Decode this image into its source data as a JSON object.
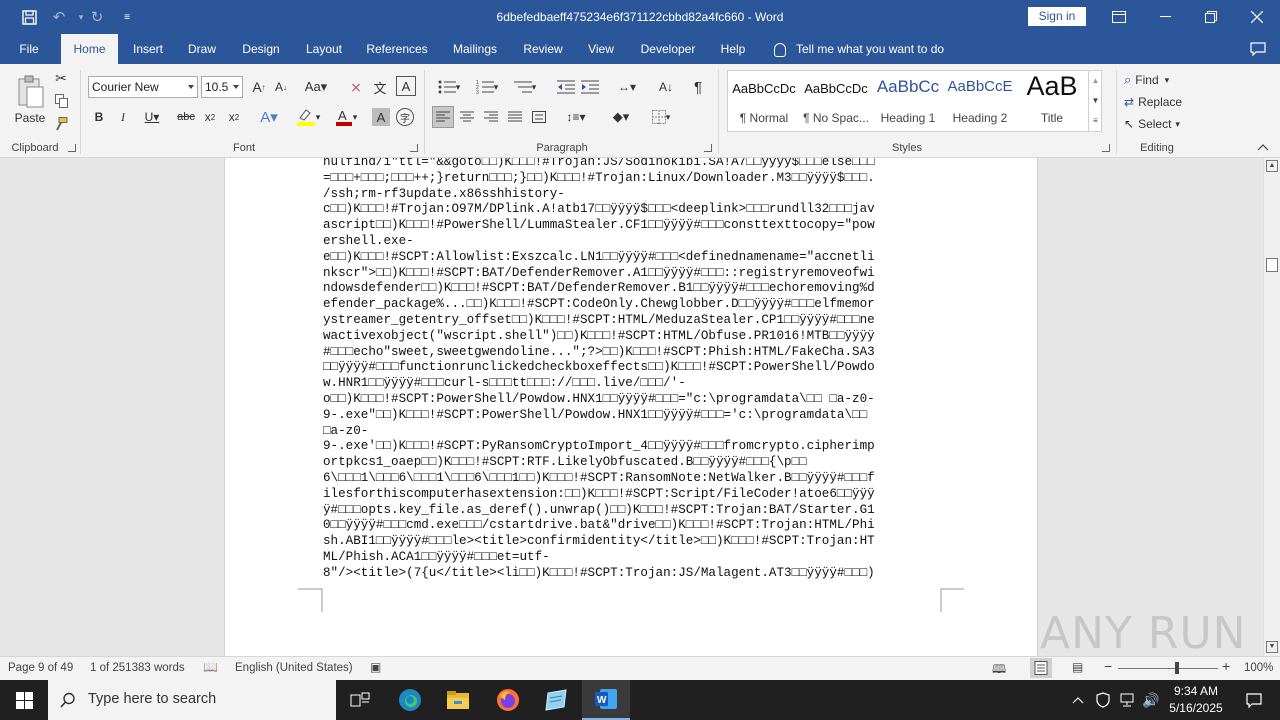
{
  "window": {
    "title": "6dbefedbaeff475234e6f371122cbbd82a4fc660  -  Word",
    "sign_in": "Sign in"
  },
  "tabs": [
    "File",
    "Home",
    "Insert",
    "Draw",
    "Design",
    "Layout",
    "References",
    "Mailings",
    "Review",
    "View",
    "Developer",
    "Help"
  ],
  "tell_me": "Tell me what you want to do",
  "ribbon": {
    "clipboard": {
      "label": "Clipboard",
      "paste": "Paste"
    },
    "font": {
      "label": "Font",
      "name": "Courier New",
      "size": "10.5"
    },
    "paragraph": {
      "label": "Paragraph"
    },
    "styles": {
      "label": "Styles",
      "items": [
        {
          "preview": "AaBbCcDc",
          "name": "¶ Normal"
        },
        {
          "preview": "AaBbCcDc",
          "name": "¶ No Spac..."
        },
        {
          "preview": "AaBbCc",
          "name": "Heading 1"
        },
        {
          "preview": "AaBbCcE",
          "name": "Heading 2"
        },
        {
          "preview": "AaB",
          "name": "Title"
        }
      ]
    },
    "editing": {
      "label": "Editing",
      "find": "Find",
      "replace": "Replace",
      "select": "Select"
    }
  },
  "document": {
    "lines": [
      "nulfind/i\"ttl=\"&&goto□□)K□□□!#Trojan:JS/Sodinokibi.SA!A7□□ÿÿÿÿ$□□□else□□□",
      "=□□□+□□□;□□□++;}return□□□;}□□)K□□□!#Trojan:Linux/Downloader.M3□□ÿÿÿÿ$□□□.",
      "/ssh;rm-rf3update.x86sshhistory-",
      "c□□)K□□□!#Trojan:O97M/DPlink.A!atb17□□ÿÿÿÿ$□□□<deeplink>□□□rundll32□□□jav",
      "ascript□□)K□□□!#PowerShell/LummaStealer.CF1□□ÿÿÿÿ#□□□consttexttocopy=\"pow",
      "ershell.exe-",
      "e□□)K□□□!#SCPT:Allowlist:Exszcalc.LN1□□ÿÿÿÿ#□□□<definednamename=\"accnetli",
      "nkscr\">□□)K□□□!#SCPT:BAT/DefenderRemover.A1□□ÿÿÿÿ#□□□::registryremoveofwi",
      "ndowsdefender□□)K□□□!#SCPT:BAT/DefenderRemover.B1□□ÿÿÿÿ#□□□echoremoving%d",
      "efender_package%...□□)K□□□!#SCPT:CodeOnly.Chewglobber.D□□ÿÿÿÿ#□□□elfmemor",
      "ystreamer_getentry_offset□□)K□□□!#SCPT:HTML/MeduzaStealer.CP1□□ÿÿÿÿ#□□□ne",
      "wactivexobject(\"wscript.shell\")□□)K□□□!#SCPT:HTML/Obfuse.PR1016!MTB□□ÿÿÿÿ",
      "#□□□echo\"sweet,sweetgwendoline...\";?>□□)K□□□!#SCPT:Phish:HTML/FakeCha.SA3",
      "□□ÿÿÿÿ#□□□functionrunclickedcheckboxeffects□□)K□□□!#SCPT:PowerShell/Powdo",
      "w.HNR1□□ÿÿÿÿ#□□□curl-s□□□tt□□□://□□□.live/□□□/'-",
      "o□□)K□□□!#SCPT:PowerShell/Powdow.HNX1□□ÿÿÿÿ#□□□=\"c:\\programdata\\□□ □a-z0-",
      "9-.exe\"□□)K□□□!#SCPT:PowerShell/Powdow.HNX1□□ÿÿÿÿ#□□□='c:\\programdata\\□□",
      "□a-z0-",
      "9-.exe'□□)K□□□!#SCPT:PyRansomCryptoImport_4□□ÿÿÿÿ#□□□fromcrypto.cipherimp",
      "ortpkcs1_oaep□□)K□□□!#SCPT:RTF.LikelyObfuscated.B□□ÿÿÿÿ#□□□{\\p□□",
      "6\\□□□1\\□□□6\\□□□1\\□□□6\\□□□1□□)K□□□!#SCPT:RansomNote:NetWalker.B□□ÿÿÿÿ#□□□f",
      "ilesforthiscomputerhasextension:□□)K□□□!#SCPT:Script/FileCoder!atoe6□□ÿÿÿ",
      "ÿ#□□□opts.key_file.as_deref().unwrap()□□)K□□□!#SCPT:Trojan:BAT/Starter.G1",
      "0□□ÿÿÿÿ#□□□cmd.exe□□□/cstartdrive.bat&\"drive□□)K□□□!#SCPT:Trojan:HTML/Phi",
      "sh.ABI1□□ÿÿÿÿ#□□□le><title>confirmidentity</title>□□)K□□□!#SCPT:Trojan:HT",
      "ML/Phish.ACA1□□ÿÿÿÿ#□□□et=utf-",
      "8\"/><title>(7{u</title><li□□)K□□□!#SCPT:Trojan:JS/Malagent.AT3□□ÿÿÿÿ#□□□)"
    ]
  },
  "status": {
    "page": "Page 9 of 49",
    "words": "1 of 251383 words",
    "language": "English (United States)",
    "zoom": "100%",
    "zoom_level": 1.0
  },
  "taskbar": {
    "search_placeholder": "Type here to search",
    "time": "9:34 AM",
    "date": "5/16/2025"
  },
  "watermark": "ANY RUN",
  "colors": {
    "word_blue": "#2b579a",
    "ribbon_bg": "#f3f3f3",
    "taskbar_bg": "#202020",
    "accent_red": "#c00000",
    "highlight_yellow": "#ffff00"
  }
}
